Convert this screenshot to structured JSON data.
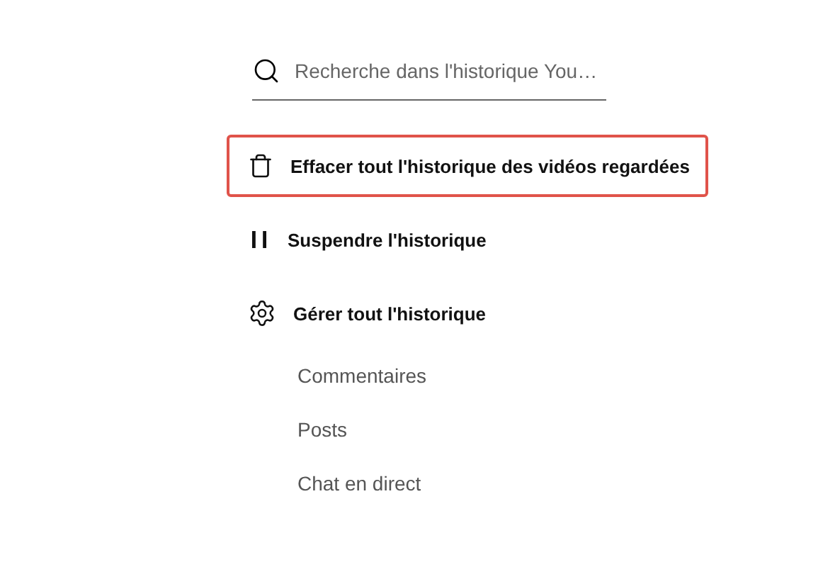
{
  "search": {
    "placeholder": "Recherche dans l'historique You…"
  },
  "actions": [
    {
      "kind": "trash",
      "label": "Effacer tout l'historique des vidéos regardées",
      "highlighted": true
    },
    {
      "kind": "pause",
      "label": "Suspendre l'historique",
      "highlighted": false
    },
    {
      "kind": "gear",
      "label": "Gérer tout l'historique",
      "highlighted": false
    }
  ],
  "sub_items": [
    "Commentaires",
    "Posts",
    "Chat en direct"
  ]
}
